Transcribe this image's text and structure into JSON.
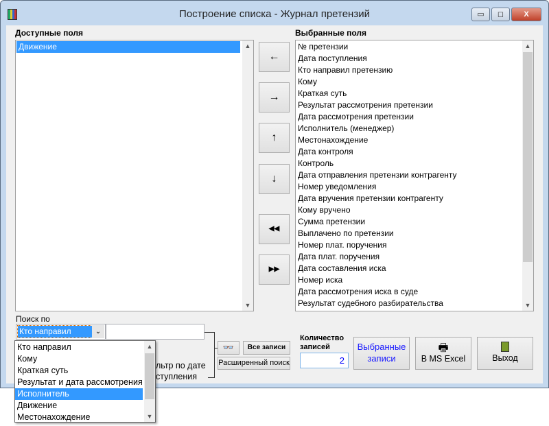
{
  "window": {
    "title": "Построение списка - Журнал претензий",
    "minimize": "▭",
    "maximize": "◻",
    "close": "X"
  },
  "available": {
    "label": "Доступные поля",
    "items": [
      "Движение"
    ]
  },
  "selected": {
    "label": "Выбранные поля",
    "items": [
      "№ претензии",
      "Дата поступления",
      "Кто направил претензию",
      "Кому",
      "Краткая суть",
      "Результат рассмотрения претензии",
      "Дата рассмотрения претензии",
      "Исполнитель (менеджер)",
      "Местонахождение",
      "Дата контроля",
      "Контроль",
      "Дата отправления претензии контрагенту",
      "Номер уведомления",
      "Дата вручения претензии контрагенту",
      "Кому вручено",
      "Сумма претензии",
      "Выплачено по претензии",
      "Номер плат. поручения",
      "Дата плат. поручения",
      "Дата составления иска",
      "Номер иска",
      "Дата рассмотрения иска в суде",
      "Результат судебного разбирательства"
    ]
  },
  "move_buttons": {
    "left": "←",
    "right": "→",
    "up": "↑",
    "down": "↓",
    "all_left": "◀◀",
    "all_right": "▶▶"
  },
  "search": {
    "label": "Поиск по",
    "selected": "Кто направил",
    "value": "",
    "options": [
      "Кто направил",
      "Кому",
      "Краткая суть",
      "Результат и дата рассмотрения",
      "Исполнитель",
      "Движение",
      "Местонахождение"
    ],
    "highlighted": "Исполнитель",
    "filter_line1": "льтр по дате",
    "filter_line2": "ступления",
    "all_records": "Все записи",
    "advanced": "Расширенный поиск"
  },
  "count": {
    "label1": "Количество",
    "label2": "записей",
    "value": "2"
  },
  "actions": {
    "selected_line1": "Выбранные",
    "selected_line2": "записи",
    "excel": "В MS Excel",
    "exit": "Выход"
  }
}
